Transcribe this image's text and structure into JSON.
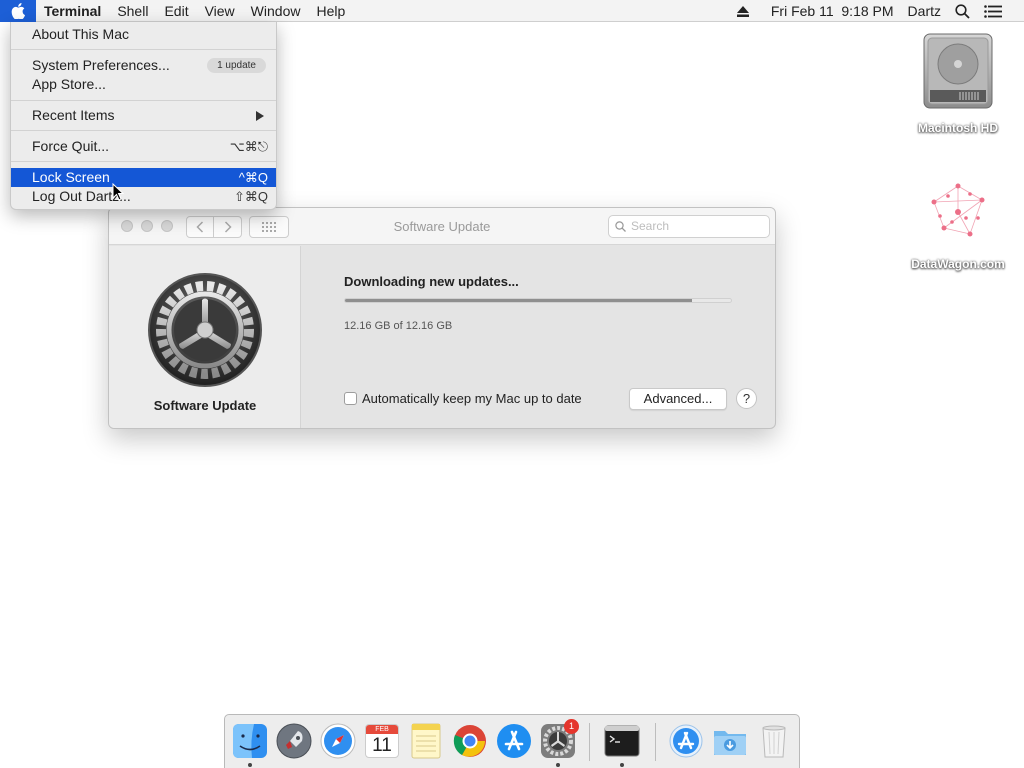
{
  "menubar": {
    "app_name": "Terminal",
    "items": [
      "Shell",
      "Edit",
      "View",
      "Window",
      "Help"
    ],
    "datetime": "Fri Feb 11  9:18 PM",
    "user": "Dartz"
  },
  "apple_menu": {
    "about": "About This Mac",
    "system_prefs": "System Preferences...",
    "update_badge": "1 update",
    "app_store": "App Store...",
    "recent_items": "Recent Items",
    "force_quit": "Force Quit...",
    "force_quit_shortcut": "⌥⌘⎋",
    "lock_screen": "Lock Screen",
    "lock_screen_shortcut": "^⌘Q",
    "log_out": "Log Out Dartz...",
    "log_out_shortcut": "⇧⌘Q"
  },
  "window": {
    "title": "Software Update",
    "search_placeholder": "Search",
    "sidebar_label": "Software Update",
    "download_title": "Downloading new updates...",
    "download_size": "12.16 GB of 12.16 GB",
    "progress_fraction": 0.9,
    "auto_update_label": "Automatically keep my Mac up to date",
    "auto_update_checked": false,
    "advanced_label": "Advanced...",
    "help_label": "?"
  },
  "desktop": {
    "icons": [
      {
        "label": "Macintosh HD",
        "icon": "hard-drive-icon"
      },
      {
        "label": "DataWagon.com",
        "icon": "datawagon-logo-icon"
      }
    ]
  },
  "dock": {
    "items": [
      {
        "name": "finder",
        "icon": "finder-icon",
        "running": true
      },
      {
        "name": "launchpad",
        "icon": "launchpad-icon",
        "running": false
      },
      {
        "name": "safari",
        "icon": "safari-icon",
        "running": false
      },
      {
        "name": "calendar",
        "icon": "calendar-icon",
        "running": false
      },
      {
        "name": "notes",
        "icon": "notes-icon",
        "running": false
      },
      {
        "name": "chrome",
        "icon": "chrome-icon",
        "running": false
      },
      {
        "name": "app-store",
        "icon": "app-store-icon",
        "running": false
      },
      {
        "name": "system-preferences",
        "icon": "system-preferences-icon",
        "running": true,
        "badge": "1"
      },
      {
        "name": "terminal",
        "icon": "terminal-icon",
        "running": true
      },
      {
        "name": "applications",
        "icon": "applications-folder-icon",
        "running": false
      },
      {
        "name": "downloads",
        "icon": "downloads-folder-icon",
        "running": false
      },
      {
        "name": "trash",
        "icon": "trash-icon",
        "running": false
      }
    ],
    "calendar_month": "FEB",
    "calendar_day": "11"
  },
  "colors": {
    "menu_highlight": "#1457d6",
    "apple_menu_active": "#1d5fd6",
    "badge_red": "#e5352c"
  }
}
